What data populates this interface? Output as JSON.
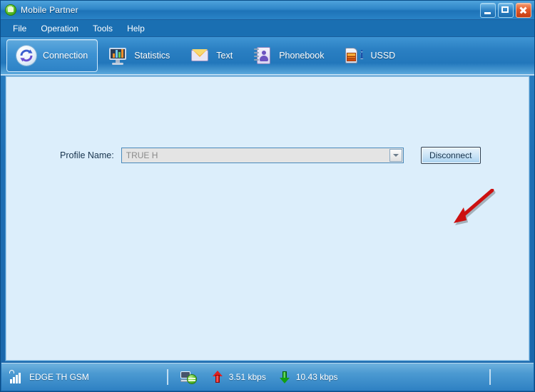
{
  "window": {
    "title": "Mobile Partner",
    "app_icon": "mobile-partner-icon",
    "controls": {
      "minimize": "minimize-icon",
      "maximize": "maximize-icon",
      "close": "close-icon"
    }
  },
  "menubar": {
    "items": [
      {
        "label": "File"
      },
      {
        "label": "Operation"
      },
      {
        "label": "Tools"
      },
      {
        "label": "Help"
      }
    ]
  },
  "toolbar": {
    "tabs": [
      {
        "label": "Connection",
        "icon": "refresh-circle-icon",
        "active": true
      },
      {
        "label": "Statistics",
        "icon": "monitor-chart-icon",
        "active": false
      },
      {
        "label": "Text",
        "icon": "envelope-icon",
        "active": false
      },
      {
        "label": "Phonebook",
        "icon": "address-book-icon",
        "active": false
      },
      {
        "label": "USSD",
        "icon": "sim-card-info-icon",
        "active": false
      }
    ]
  },
  "main": {
    "profile": {
      "label": "Profile Name:",
      "value": "TRUE H",
      "placeholder": "TRUE H",
      "disabled": true,
      "dropdown_icon": "chevron-down-icon"
    },
    "disconnect_button": "Disconnect",
    "annotation": {
      "type": "arrow",
      "color": "#cc1111",
      "points_to": "disconnect-button"
    }
  },
  "statusbar": {
    "signal_icon": "signal-bars-icon",
    "network": "EDGE  TH GSM",
    "connection_icon": "computer-connected-icon",
    "upload_icon": "arrow-up-icon",
    "upload_rate": "3.51 kbps",
    "download_icon": "arrow-down-icon",
    "download_rate": "10.43 kbps"
  },
  "colors": {
    "titlebar": "#2f86c8",
    "menubar": "#1a6fb2",
    "content_bg": "#dceefb",
    "accent": "#1d73b8",
    "annotation_red": "#cc1111",
    "upload_red": "#e02020",
    "download_green": "#12a012"
  }
}
